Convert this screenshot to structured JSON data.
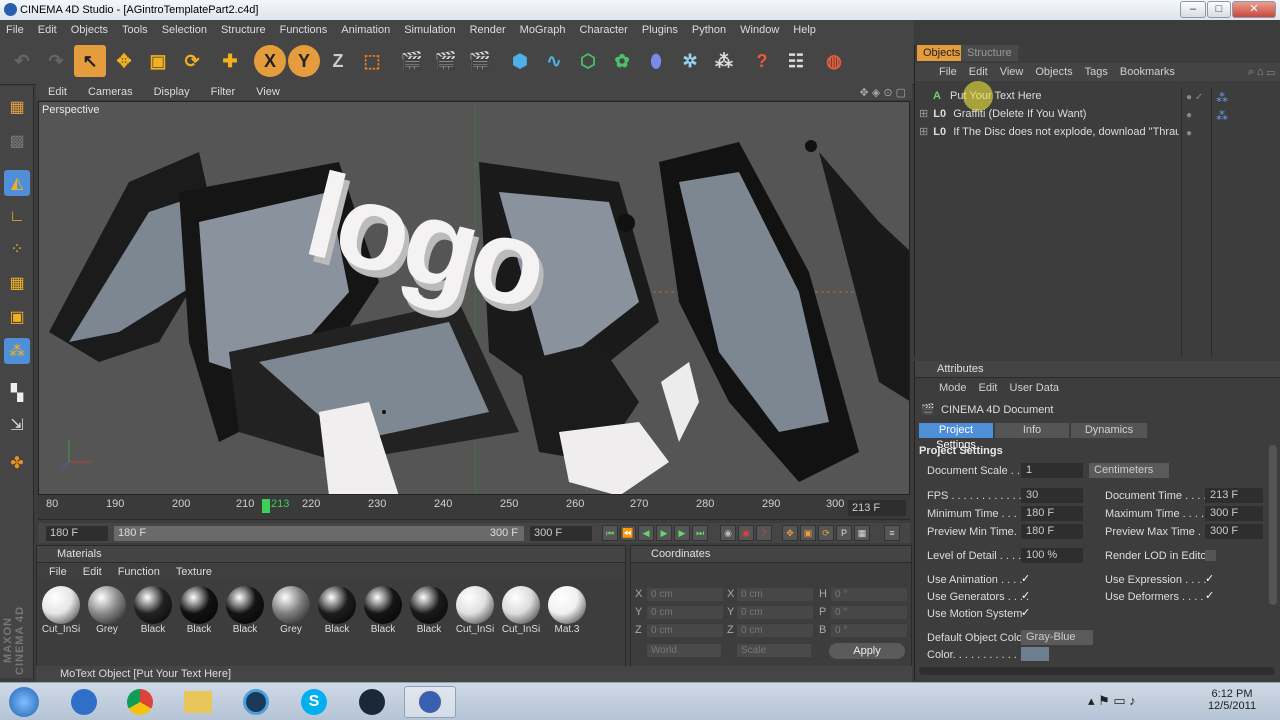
{
  "window": {
    "title": "CINEMA 4D Studio - [AGintroTemplatePart2.c4d]",
    "min": "–",
    "max": "□",
    "close": "✕"
  },
  "menu": [
    "File",
    "Edit",
    "Objects",
    "Tools",
    "Selection",
    "Structure",
    "Functions",
    "Animation",
    "Simulation",
    "Render",
    "MoGraph",
    "Character",
    "Plugins",
    "Python",
    "Window",
    "Help"
  ],
  "toolbar": {
    "icons": [
      "undo-icon",
      "redo-icon",
      "live-selection-icon",
      "move-icon",
      "scale-icon",
      "rotate-icon",
      "move-icon",
      "x-axis-icon",
      "y-axis-icon",
      "z-axis-icon",
      "coordinate-system-icon",
      "render-view-icon",
      "render-picture-icon",
      "render-settings-icon",
      "cube-icon",
      "spline-icon",
      "nurbs-icon",
      "array-icon",
      "deformer-icon",
      "scene-icon",
      "environment-icon",
      "help-icon",
      "settings-icon",
      "globe-icon"
    ],
    "x_label": "X",
    "y_label": "Y",
    "z_label": "Z"
  },
  "viewport": {
    "menu": [
      "Edit",
      "Cameras",
      "Display",
      "Filter",
      "View"
    ],
    "label": "Perspective",
    "logo_text": "logo"
  },
  "timeline": {
    "ticks": [
      "80",
      "190",
      "200",
      "210",
      "213",
      "220",
      "230",
      "240",
      "250",
      "260",
      "270",
      "280",
      "290",
      "300"
    ],
    "current_frame": "213 F"
  },
  "transport": {
    "start": "180 F",
    "range_start": "180 F",
    "range_end": "300 F",
    "end": "300 F"
  },
  "materials": {
    "title": "Materials",
    "menu": [
      "File",
      "Edit",
      "Function",
      "Texture"
    ],
    "items": [
      {
        "name": "Cut_InSi",
        "color": "#e6e6e6"
      },
      {
        "name": "Grey",
        "color": "#8a8a8a"
      },
      {
        "name": "Black",
        "color": "#222"
      },
      {
        "name": "Black",
        "color": "#111"
      },
      {
        "name": "Black",
        "color": "#141414"
      },
      {
        "name": "Grey",
        "color": "#7e7e7e"
      },
      {
        "name": "Black",
        "color": "#1c1c1c"
      },
      {
        "name": "Black",
        "color": "#151515"
      },
      {
        "name": "Black",
        "color": "#1a1a1a"
      },
      {
        "name": "Cut_InSi",
        "color": "#e0e0e0"
      },
      {
        "name": "Cut_InSi",
        "color": "#dcdcdc"
      },
      {
        "name": "Mat.3",
        "color": "#f0f0f0"
      }
    ]
  },
  "coordinates": {
    "title": "Coordinates",
    "rows": [
      {
        "a": "X",
        "av": "0 cm",
        "b": "X",
        "bv": "0 cm",
        "c": "H",
        "cv": "0 °"
      },
      {
        "a": "Y",
        "av": "0 cm",
        "b": "Y",
        "bv": "0 cm",
        "c": "P",
        "cv": "0 °"
      },
      {
        "a": "Z",
        "av": "0 cm",
        "b": "Z",
        "bv": "0 cm",
        "c": "B",
        "cv": "0 °"
      }
    ],
    "world": "World",
    "scale": "Scale",
    "apply": "Apply"
  },
  "status": "MoText Object [Put Your Text Here]",
  "objects": {
    "tabs": [
      "Objects",
      "Structure"
    ],
    "menu": [
      "File",
      "Edit",
      "View",
      "Objects",
      "Tags",
      "Bookmarks"
    ],
    "items": [
      {
        "icon": "A",
        "name": "Put Your Text Here"
      },
      {
        "icon": "L0",
        "name": "Graffiti (Delete If You Want)"
      },
      {
        "icon": "L0",
        "name": "If The Disc does not explode, download \"Thrausi\""
      }
    ]
  },
  "attributes": {
    "title": "Attributes",
    "menu": [
      "Mode",
      "Edit",
      "User Data"
    ],
    "doc_title": "CINEMA 4D Document",
    "tabs": [
      "Project Settings",
      "Info",
      "Dynamics"
    ],
    "section": "Project Settings",
    "document_scale_label": "Document Scale . .",
    "document_scale": "1",
    "units": "Centimeters",
    "fps_label": "FPS . . . . . . . . . . . .",
    "fps": "30",
    "doc_time_label": "Document Time . . . .",
    "doc_time": "213 F",
    "min_time_label": "Minimum Time . . . .",
    "min_time": "180 F",
    "max_time_label": "Maximum Time . . . .",
    "max_time": "300 F",
    "prev_min_label": "Preview Min Time. .",
    "prev_min": "180 F",
    "prev_max_label": "Preview Max Time . .",
    "prev_max": "300 F",
    "lod_label": "Level of Detail . . . .",
    "lod": "100 %",
    "render_lod_label": "Render LOD in Editor",
    "use_anim_label": "Use Animation . . . .",
    "use_expr_label": "Use Expression . . . .",
    "use_gen_label": "Use Generators . . . .",
    "use_def_label": "Use Deformers . . . .",
    "use_motion_label": "Use Motion System",
    "default_color_label": "Default Object Color",
    "default_color": "Gray-Blue",
    "color_label": "Color. . . . . . . . . . .",
    "check": "✓"
  },
  "taskbar": {
    "time": "6:12 PM",
    "date": "12/5/2011",
    "start_icon": "windows-start-icon"
  },
  "colors": {
    "accent": "#4f8fd8",
    "active_tab": "#e49c3c",
    "bg": "#3c3c3c"
  }
}
